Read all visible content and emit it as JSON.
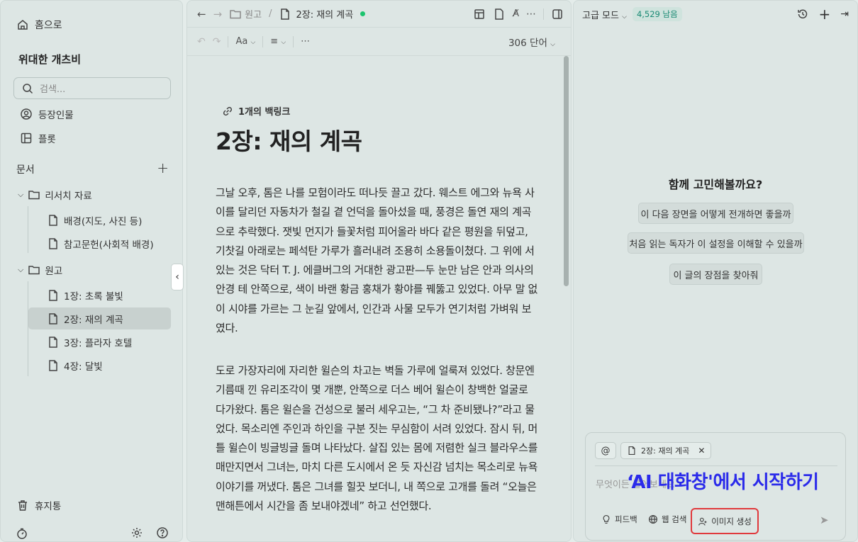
{
  "sidebar": {
    "home": "홈으로",
    "workspace": "위대한 개츠비",
    "search_placeholder": "검색...",
    "characters": "등장인물",
    "plot": "플롯",
    "documents": "문서",
    "folders": [
      {
        "label": "리서치 자료",
        "files": [
          "배경(지도, 사진 등)",
          "참고문헌(사회적 배경)"
        ]
      },
      {
        "label": "원고",
        "files": [
          "1장: 초록 불빛",
          "2장: 재의 계곡",
          "3장: 플라자 호텔",
          "4장: 달빛"
        ]
      }
    ],
    "trash": "휴지통"
  },
  "editor": {
    "breadcrumb_folder": "원고",
    "breadcrumb_doc": "2장: 재의 계곡",
    "font_control": "Aa",
    "word_count": "306 단어",
    "backlinks": "1개의 백링크",
    "title": "2장: 재의 계곡",
    "paragraphs": [
      "그날 오후, 톰은 나를 모험이라도 떠나듯 끌고 갔다. 웨스트 에그와 뉴욕 사이를 달리던 자동차가 철길 곁 언덕을 돌아섰을 때, 풍경은 돌연 재의 계곡으로 추락했다. 잿빛 먼지가 들꽃처럼 피어올라 바다 같은 평원을 뒤덮고, 기찻길 아래로는 페석탄 가루가 흘러내려 조용히 소용돌이쳤다. 그 위에 서 있는 것은 닥터 T. J. 에클버그의 거대한 광고판—두 눈만 남은 안과 의사의 안경 테 안쪽으로, 색이 바랜 황금 홍채가 황야를 꿰뚫고 있었다. 아무 말 없이 시야를 가르는 그 눈길 앞에서, 인간과 사물 모두가 연기처럼 가벼워 보였다.",
      "도로 가장자리에 자리한 윌슨의 차고는 벽돌 가루에 얼룩져 있었다. 창문엔 기름때 낀 유리조각이 몇 개뿐, 안쪽으로 더스 베어 윌슨이 창백한 얼굴로 다가왔다. 톰은 윌슨을 건성으로 불러 세우고는, “그 차 준비됐나?”라고 물었다. 목소리엔 주인과 하인을 구분 짓는 무심함이 서려 있었다. 잠시 뒤, 머틀 윌슨이 빙글빙글 돌며 나타났다. 살집 있는 몸에 저렴한 실크 블라우스를 매만지면서 그녀는, 마치 다른 도시에서 온 듯 자신감 넘치는 목소리로 뉴욕 이야기를 꺼냈다. 톰은 그녀를 힐끗 보더니, 내 쪽으로 고개를 돌려 “오늘은 맨해튼에서 시간을 좀 보내야겠네” 하고 선언했다."
    ]
  },
  "ai_panel": {
    "mode": "고급 모드",
    "remaining": "4,529 남음",
    "prompt_title": "함께 고민해볼까요?",
    "suggestions": [
      "이 다음 장면을 어떻게 전개하면 좋을까",
      "처음 읽는 독자가 이 설정을 이해할 수 있을까",
      "이 글의 장점을 찾아줘"
    ],
    "mention": "@",
    "context_doc": "2장: 재의 계곡",
    "input_placeholder": "무엇이든 물어보세요",
    "overlay_caption": "‘AI 대화창'에서 시작하기",
    "feedback": "피드백",
    "web_search": "웹 검색",
    "image_gen": "이미지 생성"
  }
}
